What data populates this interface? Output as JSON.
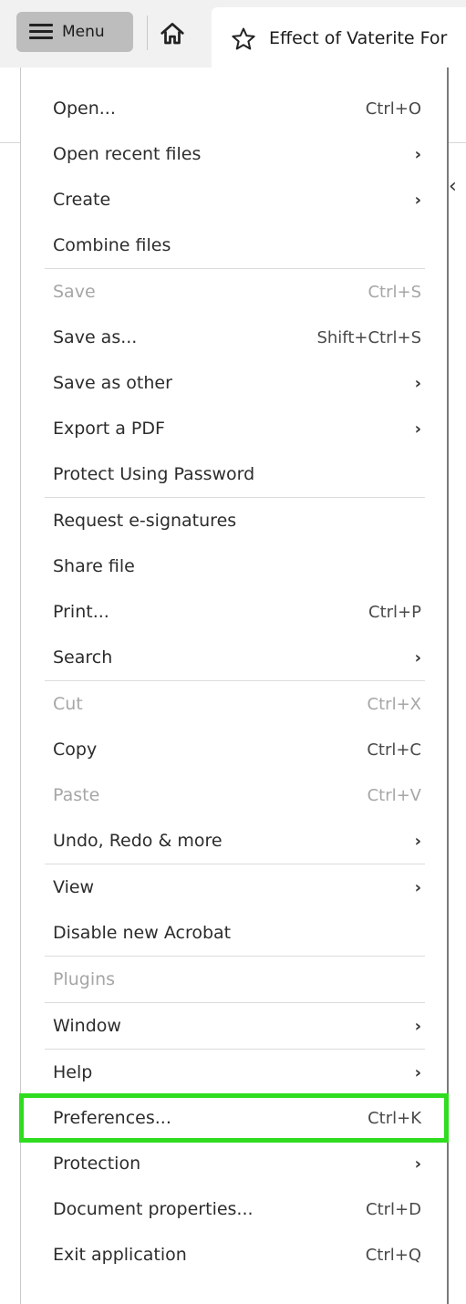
{
  "toolbar": {
    "menu_label": "Menu",
    "tab_title": "Effect of Vaterite For"
  },
  "colors": {
    "highlight": "#2fdc1f",
    "menu_button_bg": "#bdbdbd",
    "disabled_text": "#a6a6a6"
  },
  "menu": {
    "items": [
      {
        "label": "Open...",
        "shortcut": "Ctrl+O"
      },
      {
        "label": "Open recent files",
        "submenu": "›"
      },
      {
        "label": "Create",
        "submenu": "›"
      },
      {
        "label": "Combine files"
      },
      {
        "label": "Save",
        "shortcut": "Ctrl+S",
        "disabled": true
      },
      {
        "label": "Save as...",
        "shortcut": "Shift+Ctrl+S"
      },
      {
        "label": "Save as other",
        "submenu": "›"
      },
      {
        "label": "Export a PDF",
        "submenu": "›"
      },
      {
        "label": "Protect Using Password"
      },
      {
        "label": "Request e-signatures"
      },
      {
        "label": "Share file"
      },
      {
        "label": "Print...",
        "shortcut": "Ctrl+P"
      },
      {
        "label": "Search",
        "submenu": "›"
      },
      {
        "label": "Cut",
        "shortcut": "Ctrl+X",
        "disabled": true
      },
      {
        "label": "Copy",
        "shortcut": "Ctrl+C"
      },
      {
        "label": "Paste",
        "shortcut": "Ctrl+V",
        "disabled": true
      },
      {
        "label": "Undo, Redo & more",
        "submenu": "›"
      },
      {
        "label": "View",
        "submenu": "›"
      },
      {
        "label": "Disable new Acrobat"
      },
      {
        "label": "Plugins",
        "disabled": true
      },
      {
        "label": "Window",
        "submenu": "›"
      },
      {
        "label": "Help",
        "submenu": "›"
      },
      {
        "label": "Preferences...",
        "shortcut": "Ctrl+K",
        "highlighted": true
      },
      {
        "label": "Protection",
        "submenu": "›"
      },
      {
        "label": "Document properties...",
        "shortcut": "Ctrl+D"
      },
      {
        "label": "Exit application",
        "shortcut": "Ctrl+Q"
      }
    ]
  }
}
